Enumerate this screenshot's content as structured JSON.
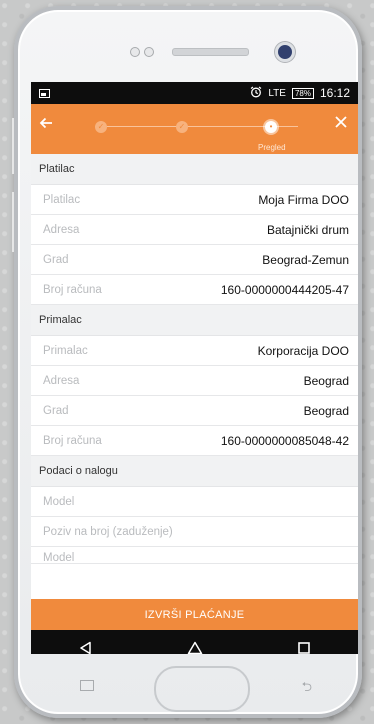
{
  "status_bar": {
    "signal_label": "LTE",
    "battery": "78%",
    "time": "16:12"
  },
  "app_bar": {
    "steps": [
      "",
      "",
      ""
    ],
    "active_step_label": "Pregled"
  },
  "sections": [
    {
      "title": "Platilac",
      "rows": [
        {
          "label": "Platilac",
          "value": "Moja Firma DOO"
        },
        {
          "label": "Adresa",
          "value": "Batajnički drum"
        },
        {
          "label": "Grad",
          "value": "Beograd-Zemun"
        },
        {
          "label": "Broj računa",
          "value": "160-0000000444205-47"
        }
      ]
    },
    {
      "title": "Primalac",
      "rows": [
        {
          "label": "Primalac",
          "value": "Korporacija DOO"
        },
        {
          "label": "Adresa",
          "value": "Beograd"
        },
        {
          "label": "Grad",
          "value": "Beograd"
        },
        {
          "label": "Broj računa",
          "value": "160-0000000085048-42"
        }
      ]
    },
    {
      "title": "Podaci o nalogu",
      "rows": [
        {
          "label": "Model",
          "value": ""
        },
        {
          "label": "Poziv na broj (zaduženje)",
          "value": ""
        },
        {
          "label": "Model",
          "value": ""
        }
      ]
    }
  ],
  "pay_button": "IZVRŠI PLAĆANJE",
  "colors": {
    "accent": "#f08a3d",
    "bar": "#0d0d0d"
  },
  "icons": [
    "back-arrow-icon",
    "close-icon",
    "check-icon",
    "alarm-clock-icon",
    "image-icon",
    "nav-back-icon",
    "nav-home-icon",
    "nav-recents-icon"
  ]
}
